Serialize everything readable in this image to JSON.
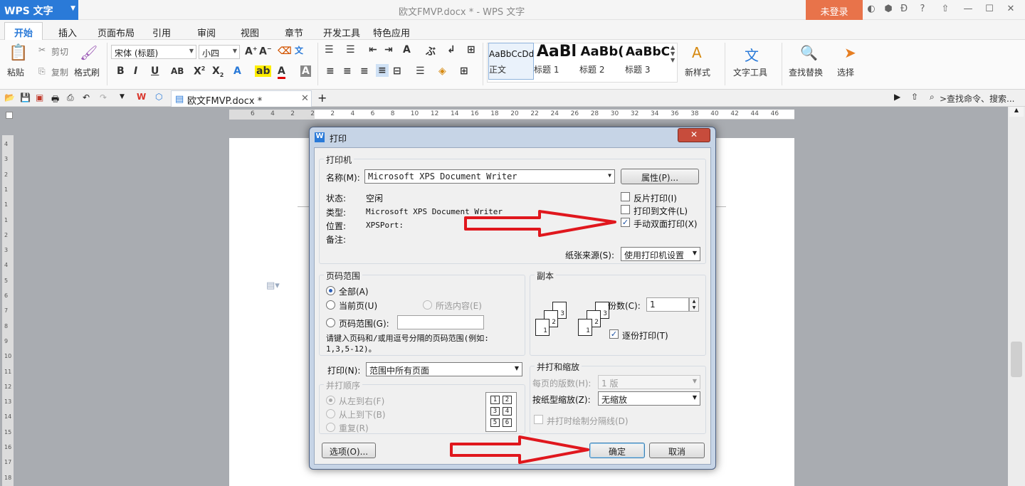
{
  "app": {
    "logo": "WPS 文字",
    "window_title": "欧文FMVP.docx * - WPS 文字",
    "login": "未登录"
  },
  "menu_tabs": [
    "开始",
    "插入",
    "页面布局",
    "引用",
    "审阅",
    "视图",
    "章节",
    "开发工具",
    "特色应用"
  ],
  "ribbon": {
    "paste": "粘贴",
    "cut": "剪切",
    "copy": "复制",
    "format_painter": "格式刷",
    "font_name": "宋体 (标题)",
    "font_size": "小四",
    "styles": [
      {
        "preview": "AaBbCcDd",
        "label": "正文"
      },
      {
        "preview": "AaBl",
        "label": "标题 1"
      },
      {
        "preview": "AaBb(",
        "label": "标题 2"
      },
      {
        "preview": "AaBbC",
        "label": "标题 3"
      }
    ],
    "new_style": "新样式",
    "text_tools": "文字工具",
    "find_replace": "查找替换",
    "select": "选择"
  },
  "quick": {
    "doc_tab": "欧文FMVP.docx *",
    "search_cmd": ">查找命令、搜索..."
  },
  "ruler": {
    "h_ticks": [
      "6",
      "4",
      "2",
      "2",
      "2",
      "4",
      "6",
      "8",
      "10",
      "12",
      "14",
      "16",
      "18",
      "20",
      "22",
      "24",
      "26",
      "28",
      "30",
      "32",
      "34",
      "36",
      "38",
      "40",
      "42",
      "44",
      "46"
    ],
    "v_ticks": [
      "4",
      "3",
      "2",
      "1",
      "1",
      "1",
      "2",
      "3",
      "4",
      "5",
      "6",
      "7",
      "8",
      "9",
      "10",
      "11",
      "12",
      "13",
      "14",
      "15",
      "16",
      "17",
      "18"
    ]
  },
  "dialog": {
    "title": "打印",
    "printer_group": "打印机",
    "name_label": "名称(M):",
    "printer_name": "Microsoft XPS Document Writer",
    "properties_btn": "属性(P)...",
    "status_label": "状态:",
    "status_value": "空闲",
    "type_label": "类型:",
    "type_value": "Microsoft XPS Document Writer",
    "where_label": "位置:",
    "where_value": "XPSPort:",
    "comment_label": "备注:",
    "reverse_print": "反片打印(I)",
    "print_to_file": "打印到文件(L)",
    "manual_duplex": "手动双面打印(X)",
    "manual_duplex_checked": true,
    "paper_source_label": "纸张来源(S):",
    "paper_source_value": "使用打印机设置",
    "range_group": "页码范围",
    "range_all": "全部(A)",
    "range_current": "当前页(U)",
    "range_selection": "所选内容(E)",
    "range_pages": "页码范围(G):",
    "range_hint": "请键入页码和/或用逗号分隔的页码范围(例如: 1,3,5-12)。",
    "copies_group": "副本",
    "copies_label": "份数(C):",
    "copies_value": "1",
    "collate": "逐份打印(T)",
    "collate_checked": true,
    "print_label": "打印(N):",
    "print_value": "范围中所有页面",
    "order_group": "并打顺序",
    "order_lr": "从左到右(F)",
    "order_tb": "从上到下(B)",
    "order_repeat": "重复(R)",
    "scale_group": "并打和缩放",
    "pages_per_sheet_label": "每页的版数(H):",
    "pages_per_sheet_value": "1 版",
    "scale_label": "按纸型缩放(Z):",
    "scale_value": "无缩放",
    "draw_borders": "并打时绘制分隔线(D)",
    "options_btn": "选项(O)...",
    "ok_btn": "确定",
    "cancel_btn": "取消",
    "sheet_numbers": [
      "1",
      "2",
      "3",
      "4",
      "5",
      "6"
    ]
  },
  "colors": {
    "accent": "#2a7ad8",
    "login_bg": "#e8734a",
    "arrow": "#e0171d"
  }
}
